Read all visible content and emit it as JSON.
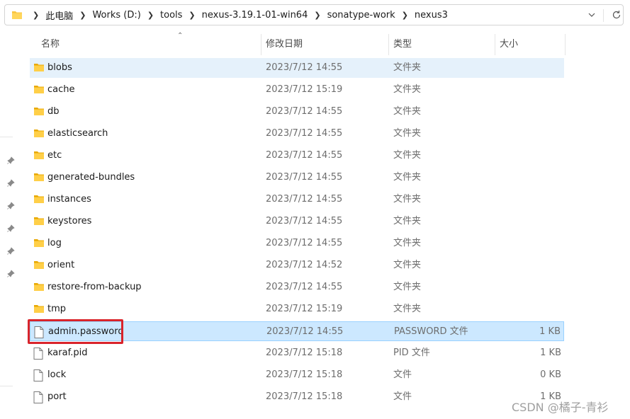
{
  "address_bar": {
    "segments": [
      "此电脑",
      "Works (D:)",
      "tools",
      "nexus-3.19.1-01-win64",
      "sonatype-work",
      "nexus3"
    ]
  },
  "columns": {
    "name": "名称",
    "modified": "修改日期",
    "type": "类型",
    "size": "大小"
  },
  "files": [
    {
      "name": "blobs",
      "modified": "2023/7/12 14:55",
      "type": "文件夹",
      "size": "",
      "icon": "folder-icon"
    },
    {
      "name": "cache",
      "modified": "2023/7/12 15:19",
      "type": "文件夹",
      "size": "",
      "icon": "folder-icon"
    },
    {
      "name": "db",
      "modified": "2023/7/12 14:55",
      "type": "文件夹",
      "size": "",
      "icon": "folder-icon"
    },
    {
      "name": "elasticsearch",
      "modified": "2023/7/12 14:55",
      "type": "文件夹",
      "size": "",
      "icon": "folder-icon"
    },
    {
      "name": "etc",
      "modified": "2023/7/12 14:55",
      "type": "文件夹",
      "size": "",
      "icon": "folder-icon"
    },
    {
      "name": "generated-bundles",
      "modified": "2023/7/12 14:55",
      "type": "文件夹",
      "size": "",
      "icon": "folder-icon"
    },
    {
      "name": "instances",
      "modified": "2023/7/12 14:55",
      "type": "文件夹",
      "size": "",
      "icon": "folder-icon"
    },
    {
      "name": "keystores",
      "modified": "2023/7/12 14:55",
      "type": "文件夹",
      "size": "",
      "icon": "folder-icon"
    },
    {
      "name": "log",
      "modified": "2023/7/12 14:55",
      "type": "文件夹",
      "size": "",
      "icon": "folder-icon"
    },
    {
      "name": "orient",
      "modified": "2023/7/12 14:52",
      "type": "文件夹",
      "size": "",
      "icon": "folder-icon"
    },
    {
      "name": "restore-from-backup",
      "modified": "2023/7/12 14:55",
      "type": "文件夹",
      "size": "",
      "icon": "folder-icon"
    },
    {
      "name": "tmp",
      "modified": "2023/7/12 15:19",
      "type": "文件夹",
      "size": "",
      "icon": "folder-icon"
    },
    {
      "name": "admin.password",
      "modified": "2023/7/12 14:55",
      "type": "PASSWORD 文件",
      "size": "1 KB",
      "icon": "file-icon"
    },
    {
      "name": "karaf.pid",
      "modified": "2023/7/12 15:18",
      "type": "PID 文件",
      "size": "1 KB",
      "icon": "file-icon"
    },
    {
      "name": "lock",
      "modified": "2023/7/12 15:18",
      "type": "文件",
      "size": "0 KB",
      "icon": "file-icon"
    },
    {
      "name": "port",
      "modified": "2023/7/12 15:18",
      "type": "文件",
      "size": "1 KB",
      "icon": "file-icon"
    }
  ],
  "watermark": "CSDN @橘子-青衫",
  "colors": {
    "selected_bg": "#cce8ff",
    "hover_bg": "#e5f1fb",
    "annotation_red": "#d9242b",
    "folder_yellow": "#f8c440"
  }
}
